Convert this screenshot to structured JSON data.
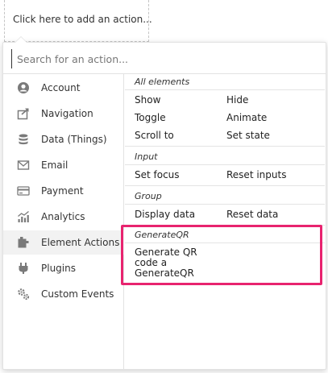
{
  "add_action": {
    "label": "Click here to add an action..."
  },
  "search": {
    "placeholder": "Search for an action...",
    "value": ""
  },
  "sidebar": {
    "items": [
      {
        "label": "Account",
        "icon": "account-icon",
        "active": false
      },
      {
        "label": "Navigation",
        "icon": "navigation-icon",
        "active": false
      },
      {
        "label": "Data (Things)",
        "icon": "database-icon",
        "active": false
      },
      {
        "label": "Email",
        "icon": "email-icon",
        "active": false
      },
      {
        "label": "Payment",
        "icon": "payment-card-icon",
        "active": false
      },
      {
        "label": "Analytics",
        "icon": "analytics-icon",
        "active": false
      },
      {
        "label": "Element Actions",
        "icon": "element-actions-icon",
        "active": true
      },
      {
        "label": "Plugins",
        "icon": "plugin-icon",
        "active": false
      },
      {
        "label": "Custom Events",
        "icon": "custom-events-gears-icon",
        "active": false
      }
    ]
  },
  "sections": {
    "all_elements": {
      "title": "All elements",
      "actions": [
        "Show",
        "Hide",
        "Toggle",
        "Animate",
        "Scroll to",
        "Set state"
      ]
    },
    "input": {
      "title": "Input",
      "actions": [
        "Set focus",
        "Reset inputs"
      ]
    },
    "group": {
      "title": "Group",
      "actions": [
        "Display data",
        "Reset data"
      ]
    },
    "generateqr": {
      "title": "GenerateQR",
      "actions": [
        "Generate QR code a GenerateQR"
      ]
    }
  },
  "colors": {
    "highlight": "#e8236f",
    "icon": "#7a7a7a",
    "active_bg": "#f2f2f2",
    "border": "#e2e2e2"
  }
}
